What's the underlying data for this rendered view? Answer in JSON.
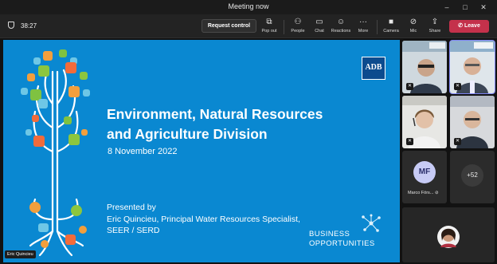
{
  "window": {
    "title": "Meeting now",
    "controls": [
      "–",
      "□",
      "✕"
    ]
  },
  "toolbar": {
    "timer": "38:27",
    "request_control": "Request control",
    "buttons": [
      {
        "label": "Pop out",
        "icon": "pop-out-icon"
      },
      {
        "label": "People",
        "icon": "people-icon"
      },
      {
        "label": "Chat",
        "icon": "chat-icon"
      },
      {
        "label": "Reactions",
        "icon": "reactions-icon"
      },
      {
        "label": "More",
        "icon": "more-icon"
      },
      {
        "label": "Camera",
        "icon": "camera-icon"
      },
      {
        "label": "Mic",
        "icon": "mic-icon"
      },
      {
        "label": "Share",
        "icon": "share-icon"
      }
    ],
    "leave": "Leave"
  },
  "slide": {
    "title_line1": "Environment, Natural Resources",
    "title_line2": "and Agriculture Division",
    "date": "8 November 2022",
    "presented_by": "Presented by",
    "presenter": "Eric Quincieu, Principal Water Resources Specialist,",
    "unit": "SEER / SERD",
    "logo": "ADB",
    "business_line1": "BUSINESS",
    "business_line2": "OPPORTUNITIES"
  },
  "presenter_tag": "Eric Quincieu",
  "participants": {
    "initials": "MF",
    "initials_name": "Marco Förs...",
    "overflow": "+52"
  },
  "colors": {
    "slide_bg": "#0a88d1",
    "leave": "#c4314b",
    "accent": "#7f85f5",
    "avatar_mf": "#c7cbf5"
  }
}
